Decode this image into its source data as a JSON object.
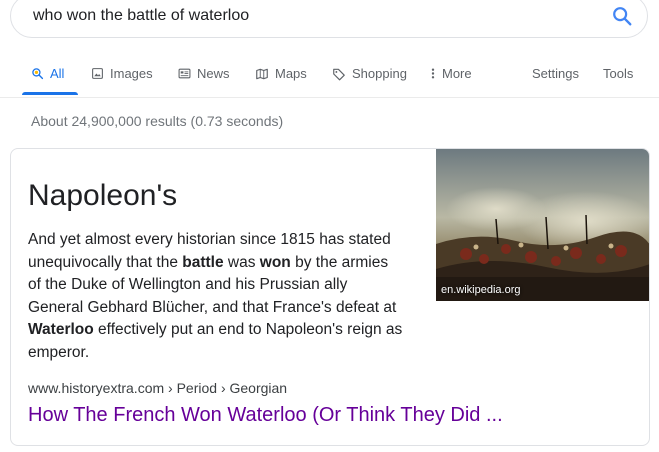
{
  "search": {
    "query": "who won the battle of waterloo",
    "icon": "search-icon"
  },
  "tabs": [
    {
      "label": "All",
      "icon": "search-icon",
      "active": true
    },
    {
      "label": "Images",
      "icon": "image-icon"
    },
    {
      "label": "News",
      "icon": "news-icon"
    },
    {
      "label": "Maps",
      "icon": "map-icon"
    },
    {
      "label": "Shopping",
      "icon": "tag-icon"
    },
    {
      "label": "More",
      "icon": "more-vert-icon"
    }
  ],
  "tools": {
    "settings_label": "Settings",
    "tools_label": "Tools"
  },
  "result_stats": "About 24,900,000 results (0.73 seconds)",
  "featured_snippet": {
    "answer": "Napoleon's",
    "snippet_parts": [
      {
        "text": "And yet almost every historian since 1815 has stated unequivocally that the "
      },
      {
        "text": "battle",
        "bold": true
      },
      {
        "text": " was "
      },
      {
        "text": "won",
        "bold": true
      },
      {
        "text": " by the armies of the Duke of Wellington and his Prussian ally General Gebhard Blücher, and that France's defeat at "
      },
      {
        "text": "Waterloo",
        "bold": true
      },
      {
        "text": " effectively put an end to Napoleon's reign as emperor."
      }
    ],
    "image_caption": "en.wikipedia.org",
    "cite": "www.historyextra.com › Period › Georgian",
    "link_title": "How The French Won Waterloo (Or Think They Did ...",
    "colors": {
      "link_visited": "#660099",
      "accent": "#1a73e8",
      "muted": "#70757a"
    }
  }
}
